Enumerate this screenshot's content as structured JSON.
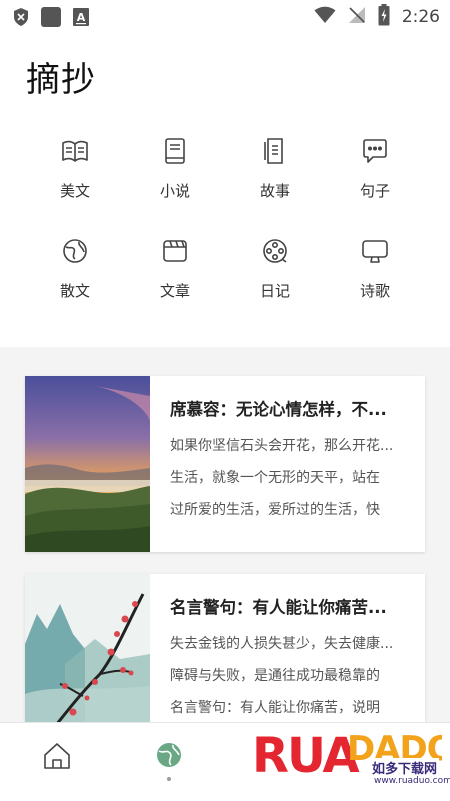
{
  "status_bar": {
    "time": "2:26",
    "icons": [
      "shield-icon",
      "square-icon",
      "font-a-icon",
      "wifi-icon",
      "no-signal-icon",
      "battery-charging-icon"
    ]
  },
  "header": {
    "title": "摘抄"
  },
  "categories": [
    {
      "label": "美文",
      "icon": "open-book-icon"
    },
    {
      "label": "小说",
      "icon": "book-icon"
    },
    {
      "label": "故事",
      "icon": "stacked-pages-icon"
    },
    {
      "label": "句子",
      "icon": "chat-bubble-icon"
    },
    {
      "label": "散文",
      "icon": "globe-icon"
    },
    {
      "label": "文章",
      "icon": "clapperboard-icon"
    },
    {
      "label": "日记",
      "icon": "film-reel-icon"
    },
    {
      "label": "诗歌",
      "icon": "monitor-icon"
    }
  ],
  "articles": [
    {
      "title": "席慕容：无论心情怎样，不...",
      "lines": [
        "如果你坚信石头会开花，那么开花...",
        "生活，就象一个无形的天平，站在",
        "过所爱的生活，爱所过的生活，快"
      ],
      "image": "sunset-mountain-landscape"
    },
    {
      "title": "名言警句：有人能让你痛苦...",
      "lines": [
        "失去金钱的人损失甚少，失去健康...",
        "障碍与失败，是通往成功最稳靠的",
        "名言警句：有人能让你痛苦，说明"
      ],
      "image": "ink-painting-plum-blossom"
    }
  ],
  "tabbar": {
    "tabs": [
      {
        "name": "home",
        "icon": "home-icon"
      },
      {
        "name": "discover",
        "icon": "planet-icon",
        "active": true
      }
    ]
  },
  "watermark": {
    "text": "RUADADO",
    "subtitle": "如多下载网",
    "url": "www.ruaduo.com"
  },
  "colors": {
    "accent": "#6aa885",
    "text": "#222222",
    "feed_bg": "#f4f4f4"
  }
}
